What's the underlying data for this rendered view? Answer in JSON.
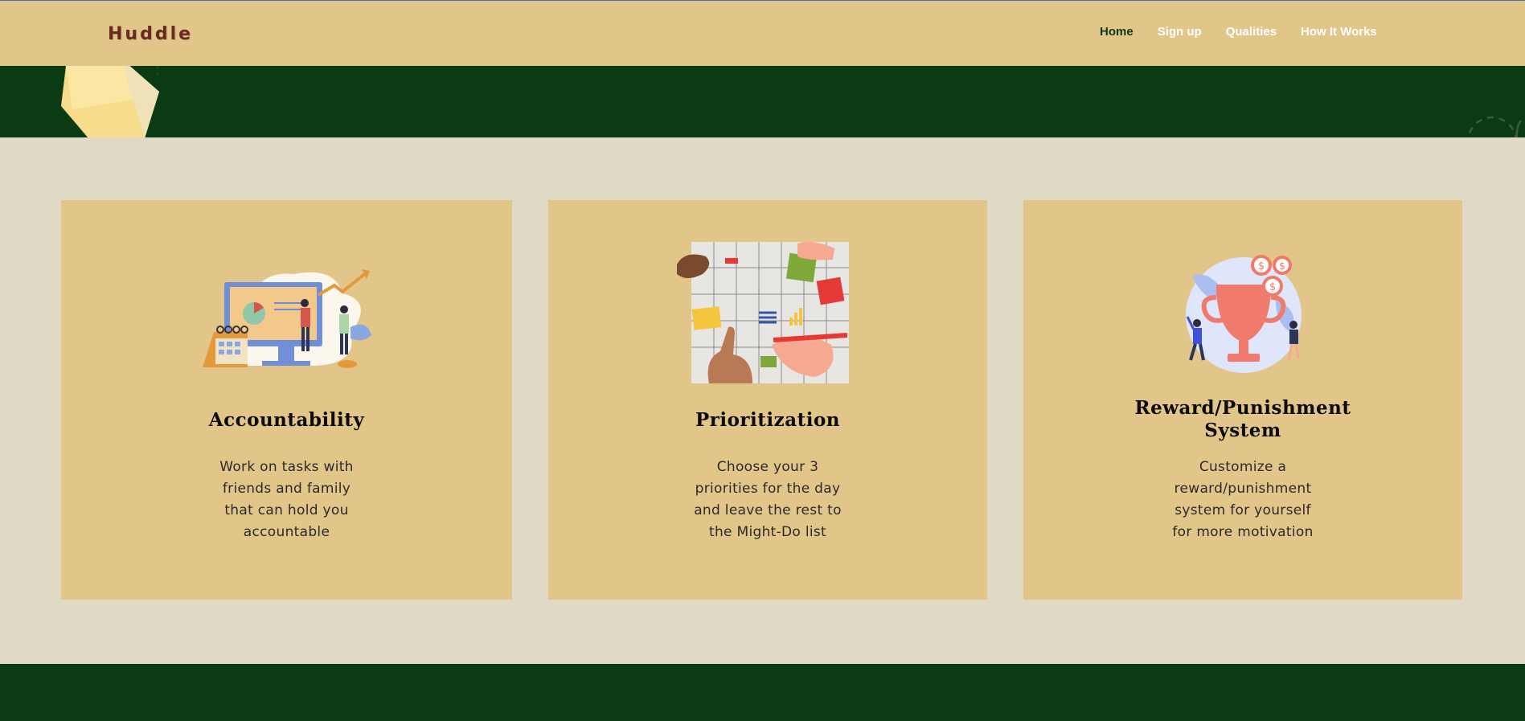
{
  "header": {
    "logo": "Huddle",
    "nav": [
      {
        "label": "Home",
        "active": true
      },
      {
        "label": "Sign up",
        "active": false
      },
      {
        "label": "Qualities",
        "active": false
      },
      {
        "label": "How It Works",
        "active": false
      }
    ]
  },
  "colors": {
    "header_bg": "#e2c589",
    "band_green": "#0b3b12",
    "page_bg": "#e0d9c6",
    "card_bg": "#e2c589",
    "logo": "#6b2a20"
  },
  "cards": [
    {
      "title": "Accountability",
      "desc_lines": [
        "Work on tasks with",
        "friends and family",
        "that can hold you",
        "accountable"
      ],
      "icon": "presentation-illustration"
    },
    {
      "title": "Prioritization",
      "desc_lines": [
        "Choose your 3",
        "priorities for the day",
        "and leave the rest to",
        "the Might-Do list"
      ],
      "icon": "calendar-illustration"
    },
    {
      "title_lines": [
        "Reward/Punishment",
        "System"
      ],
      "desc_lines": [
        "Customize a",
        "reward/punishment",
        "system for yourself",
        "for more motivation"
      ],
      "icon": "trophy-illustration"
    }
  ]
}
